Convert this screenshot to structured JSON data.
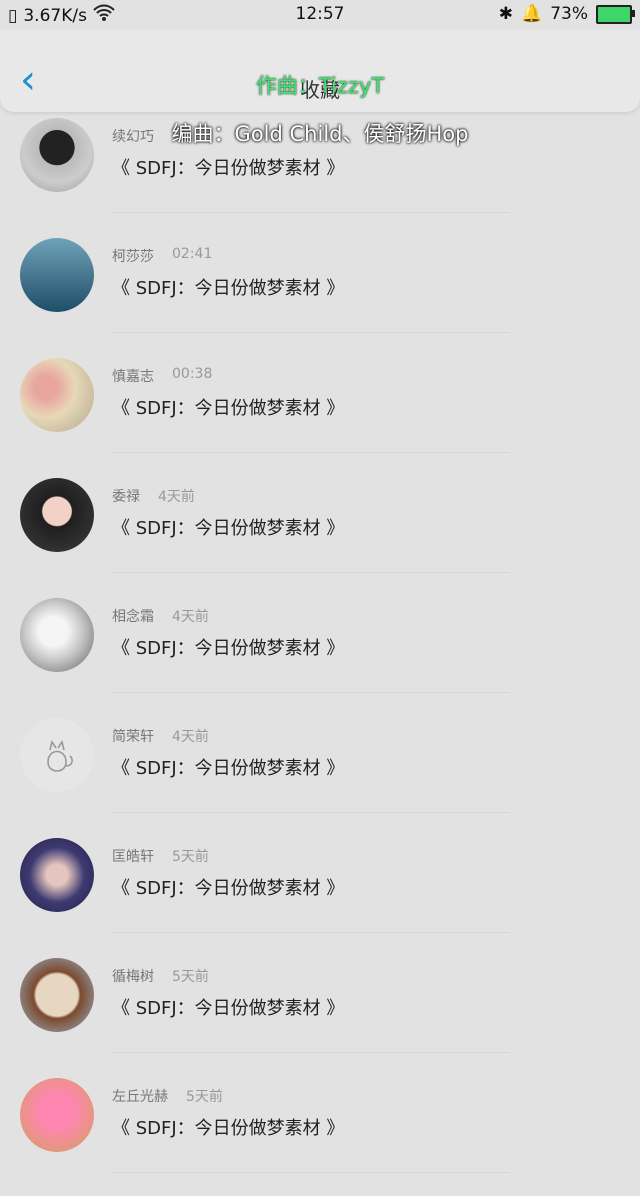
{
  "statusbar": {
    "speed": "3.67K/s",
    "time": "12:57",
    "battery": "73%"
  },
  "nav": {
    "title": "收藏"
  },
  "overlay": {
    "line1": "作曲：TizzyT",
    "line2": "编曲：Gold Child、侯舒扬Hop"
  },
  "list": [
    {
      "name": "续幻巧",
      "time": "",
      "message": "《 SDFJ：今日份做梦素材 》"
    },
    {
      "name": "柯莎莎",
      "time": "02:41",
      "message": "《 SDFJ：今日份做梦素材 》"
    },
    {
      "name": "慎嘉志",
      "time": "00:38",
      "message": "《 SDFJ：今日份做梦素材 》"
    },
    {
      "name": "委禄",
      "time": "4天前",
      "message": "《 SDFJ：今日份做梦素材 》"
    },
    {
      "name": "相念霜",
      "time": "4天前",
      "message": "《 SDFJ：今日份做梦素材 》"
    },
    {
      "name": "简荣轩",
      "time": "4天前",
      "message": "《 SDFJ：今日份做梦素材 》"
    },
    {
      "name": "匡皓轩",
      "time": "5天前",
      "message": "《 SDFJ：今日份做梦素材 》"
    },
    {
      "name": "循梅树",
      "time": "5天前",
      "message": "《 SDFJ：今日份做梦素材 》"
    },
    {
      "name": "左丘光赫",
      "time": "5天前",
      "message": "《 SDFJ：今日份做梦素材 》"
    }
  ]
}
